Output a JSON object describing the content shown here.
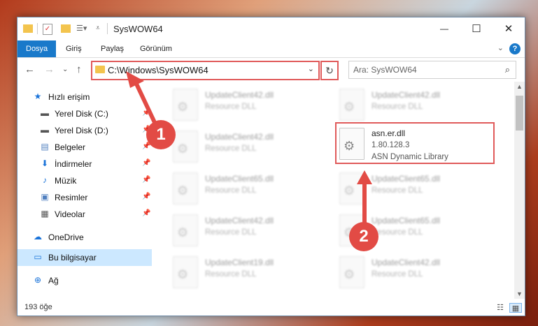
{
  "window": {
    "title": "SysWOW64",
    "controls": {
      "minimize": "—",
      "maximize": "☐",
      "close": "✕"
    }
  },
  "ribbon": {
    "tabs": [
      "Dosya",
      "Giriş",
      "Paylaş",
      "Görünüm"
    ],
    "help": "?",
    "collapse": "⌄"
  },
  "address": {
    "path": "C:\\Windows\\SysWOW64",
    "search_placeholder": "Ara: SysWOW64"
  },
  "sidebar": {
    "items": [
      {
        "label": "Hızlı erişim",
        "icon": "star-icon",
        "glyph": "★",
        "color": "#1a73d9"
      },
      {
        "label": "Yerel Disk (C:)",
        "icon": "drive-icon",
        "glyph": "▬",
        "color": "#555"
      },
      {
        "label": "Yerel Disk (D:)",
        "icon": "drive-icon",
        "glyph": "▬",
        "color": "#555"
      },
      {
        "label": "Belgeler",
        "icon": "documents-icon",
        "glyph": "▤",
        "color": "#4f7fbf"
      },
      {
        "label": "İndirmeler",
        "icon": "download-icon",
        "glyph": "⬇",
        "color": "#1a73d9"
      },
      {
        "label": "Müzik",
        "icon": "music-icon",
        "glyph": "♪",
        "color": "#1a73d9"
      },
      {
        "label": "Resimler",
        "icon": "pictures-icon",
        "glyph": "▣",
        "color": "#4f7fbf"
      },
      {
        "label": "Videolar",
        "icon": "videos-icon",
        "glyph": "▦",
        "color": "#555"
      },
      {
        "label": "OneDrive",
        "icon": "cloud-icon",
        "glyph": "☁",
        "color": "#1a73d9"
      },
      {
        "label": "Bu bilgisayar",
        "icon": "computer-icon",
        "glyph": "▭",
        "color": "#1a73d9"
      },
      {
        "label": "Ağ",
        "icon": "network-icon",
        "glyph": "⊕",
        "color": "#1a73d9"
      }
    ]
  },
  "files": [
    {
      "name": "UpdateClient42.dll",
      "type": "Resource DLL"
    },
    {
      "name": "UpdateClient42.dll",
      "type": "Resource DLL"
    },
    {
      "name": "UpdateClient42.dll",
      "type": "Resource DLL"
    },
    {
      "name": "asn.er.dll",
      "version": "1.80.128.3",
      "type": "ASN Dynamic Library"
    },
    {
      "name": "UpdateClient65.dll",
      "type": "Resource DLL"
    },
    {
      "name": "UpdateClient65.dll",
      "type": "Resource DLL"
    },
    {
      "name": "UpdateClient42.dll",
      "type": "Resource DLL"
    },
    {
      "name": "UpdateClient65.dll",
      "type": "Resource DLL"
    },
    {
      "name": "UpdateClient19.dll",
      "type": "Resource DLL"
    },
    {
      "name": "UpdateClient42.dll",
      "type": "Resource DLL"
    }
  ],
  "status": {
    "count": "193 öğe"
  },
  "annotations": {
    "badge1": "1",
    "badge2": "2"
  }
}
